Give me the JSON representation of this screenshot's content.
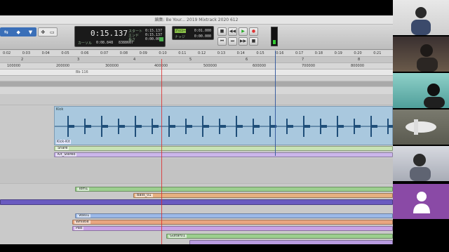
{
  "window": {
    "title": "編集: Be Your... 2019 Mixtrack 2020 612"
  },
  "toolbar": {
    "edit_modes": [
      "⇆",
      "◆",
      "▼"
    ],
    "edit_tools": [
      "✥",
      "▭"
    ],
    "main_counter": "0:15.137",
    "cursor_label": "カーソル",
    "cursor_value": "0:08.848",
    "samples_value": "8388607",
    "start_label": "スタート",
    "end_label": "エンド",
    "length_label": "長さ",
    "start_value": "0:15.137",
    "end_value": "0:15.137",
    "length_value": "0:00.000",
    "preroll_label": "プリロール",
    "preroll_value": "0:01.000",
    "postroll_label": "ナッジ",
    "postroll_value": "0:00.000",
    "transport_buttons": [
      "■",
      "◀◀",
      "▶",
      "●",
      "⏮",
      "⏭",
      "▶▶",
      "■"
    ]
  },
  "rulers": {
    "minsecs": [
      "0:02",
      "0:03",
      "0:04",
      "0:05",
      "0:06",
      "0:07",
      "0:08",
      "0:09",
      "0:10",
      "0:11",
      "0:12",
      "0:13",
      "0:14",
      "0:15",
      "0:16",
      "0:17",
      "0:18",
      "0:19",
      "0:20",
      "0:21"
    ],
    "bars": [
      "2",
      "3",
      "4",
      "5",
      "6",
      "7",
      "8"
    ],
    "samples": [
      "100000",
      "200000",
      "300000",
      "400000",
      "500000",
      "600000",
      "700000",
      "800000"
    ],
    "marker": "Bb 116"
  },
  "tracks": {
    "kick_clip_name": "Kick",
    "kick_bottom_name": "Kick-Kit",
    "clips": [
      {
        "label": "Snare"
      },
      {
        "label": "Kit_Stereo"
      },
      {
        "label": "Tom1"
      },
      {
        "label": "Bass_01"
      },
      {
        "label": "Vox01"
      },
      {
        "label": "Whistle"
      },
      {
        "label": "Pad"
      },
      {
        "label": "Guitar01"
      }
    ]
  },
  "participants": [
    "participant-1",
    "participant-2",
    "participant-3",
    "participant-4",
    "participant-5",
    "participant-6"
  ],
  "colors": {
    "audio_clip": "#a9c8de",
    "green_clip": "#9ccf8e",
    "purple_clip": "#b89be0",
    "orange_clip": "#e6b080",
    "avatar_bg": "#8a4aa6"
  }
}
